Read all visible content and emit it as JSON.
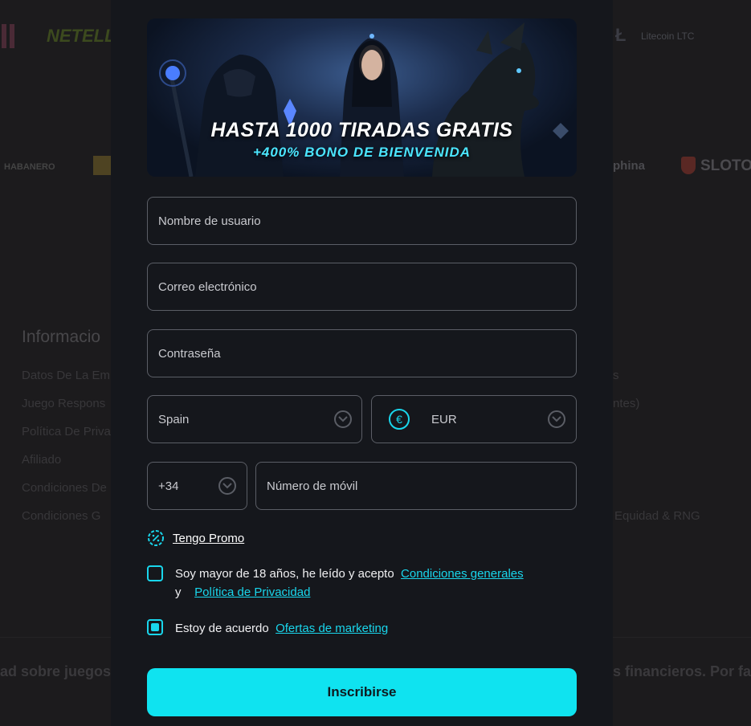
{
  "background": {
    "logos": {
      "neteller": "NETELLER",
      "litecoin": "Litecoin LTC",
      "habanero": "HABANERO",
      "phina": "phina",
      "sloto": "SLOTO"
    },
    "info_heading": "Informacio",
    "left_links": [
      "Datos De La Em",
      "Juego Respons",
      "Política De Priva",
      "Afiliado",
      "Condiciones De",
      "Condiciones G"
    ],
    "right_links": [
      "s",
      "ntes)",
      "Equidad & RNG"
    ],
    "footer_left": "ad sobre juegos",
    "footer_right": "s financieros. Por fav"
  },
  "banner": {
    "title": "HASTA 1000 TIRADAS GRATIS",
    "subtitle": "+400% BONO DE BIENVENIDA"
  },
  "form": {
    "username_placeholder": "Nombre de usuario",
    "email_placeholder": "Correo electrónico",
    "password_placeholder": "Contraseña",
    "country": "Spain",
    "currency_symbol": "€",
    "currency": "EUR",
    "phone_prefix": "+34",
    "phone_placeholder": "Número de móvil",
    "promo_label": "Tengo Promo",
    "terms_prefix": "Soy mayor de 18 años, he leído y acepto",
    "terms_link": "Condiciones generales",
    "terms_and": "y",
    "privacy_link": "Política de Privacidad",
    "terms_checked": false,
    "marketing_prefix": "Estoy de acuerdo",
    "marketing_link": "Ofertas de marketing",
    "marketing_checked": true,
    "submit_label": "Inscribirse"
  },
  "colors": {
    "accent": "#0fe3f0",
    "modal_bg": "#15171c",
    "field_border": "#5b5e66"
  }
}
